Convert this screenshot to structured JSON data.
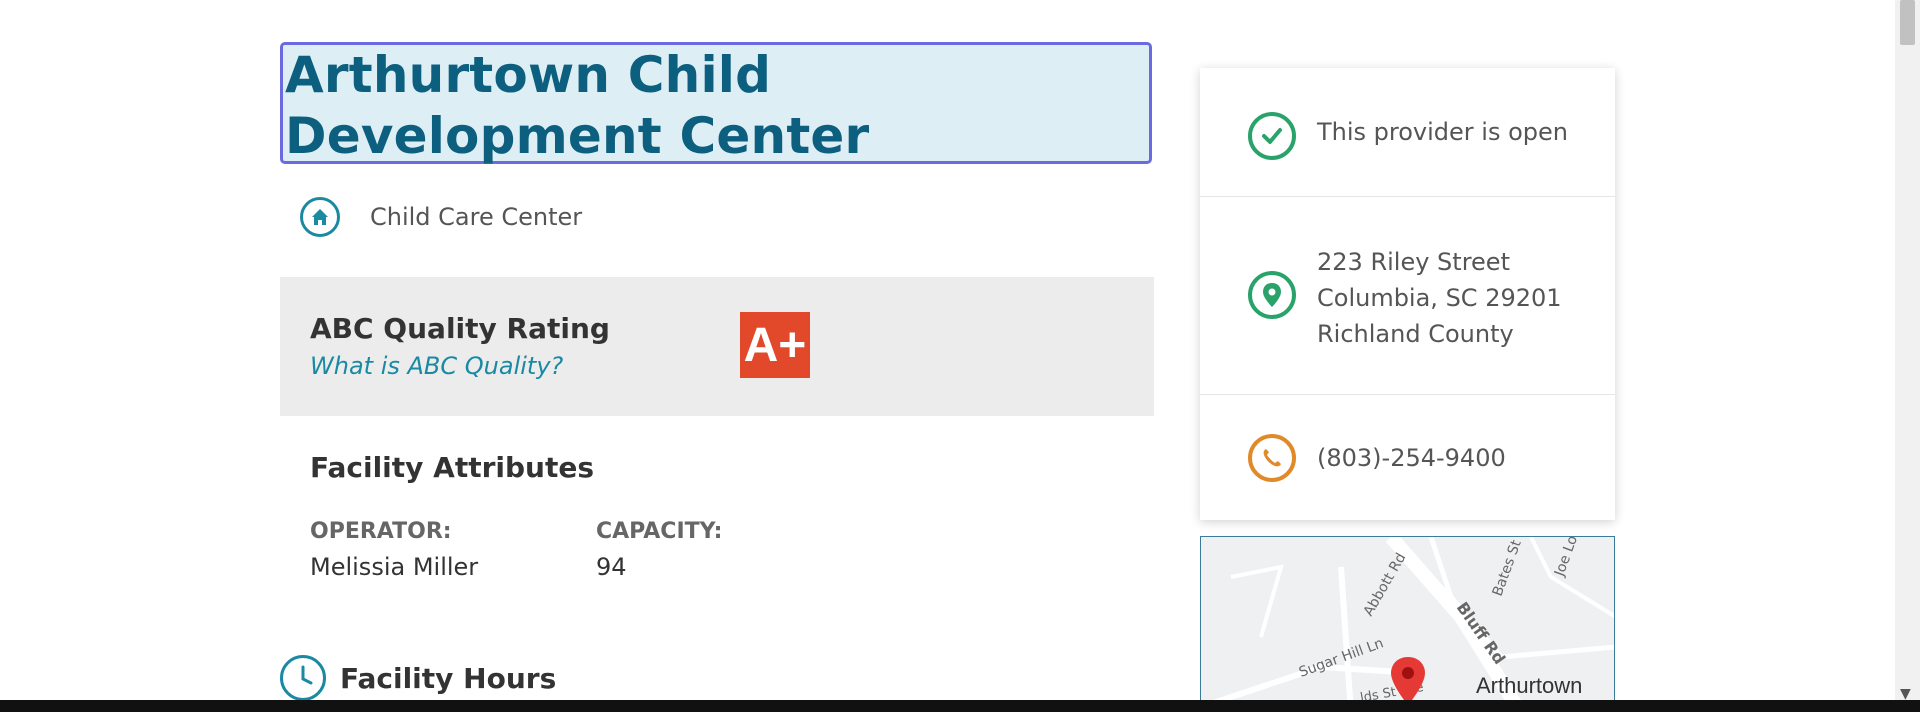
{
  "provider": {
    "name": "Arthurtown Child Development Center",
    "type_label": "Child Care Center"
  },
  "rating": {
    "title": "ABC Quality Rating",
    "link_text": "What is ABC Quality?",
    "badge": "A+"
  },
  "attributes": {
    "heading": "Facility Attributes",
    "operator_label": "OPERATOR:",
    "operator_value": "Melissia Miller",
    "capacity_label": "CAPACITY:",
    "capacity_value": "94"
  },
  "hours": {
    "heading": "Facility Hours"
  },
  "info_card": {
    "status": "This provider is open",
    "address_line1": "223 Riley Street",
    "address_line2": "Columbia, SC 29201",
    "address_line3": "Richland County",
    "phone": "(803)-254-9400"
  },
  "map": {
    "streets": [
      "Abbott Rd",
      "Bates St",
      "Joe Lo",
      "Bluff Rd",
      "Sugar Hill Ln",
      "lds St Ave"
    ],
    "place_label": "Arthurtown"
  },
  "colors": {
    "title": "#0d5f7f",
    "accent": "#1a8aa3",
    "open_green": "#2aa36a",
    "phone_orange": "#e08a2a",
    "badge_red": "#e1492a"
  },
  "icons": {
    "type": "home-icon",
    "status": "check-circle-icon",
    "address": "location-pin-icon",
    "phone": "phone-icon",
    "hours": "clock-icon",
    "map_marker": "map-marker-icon"
  }
}
